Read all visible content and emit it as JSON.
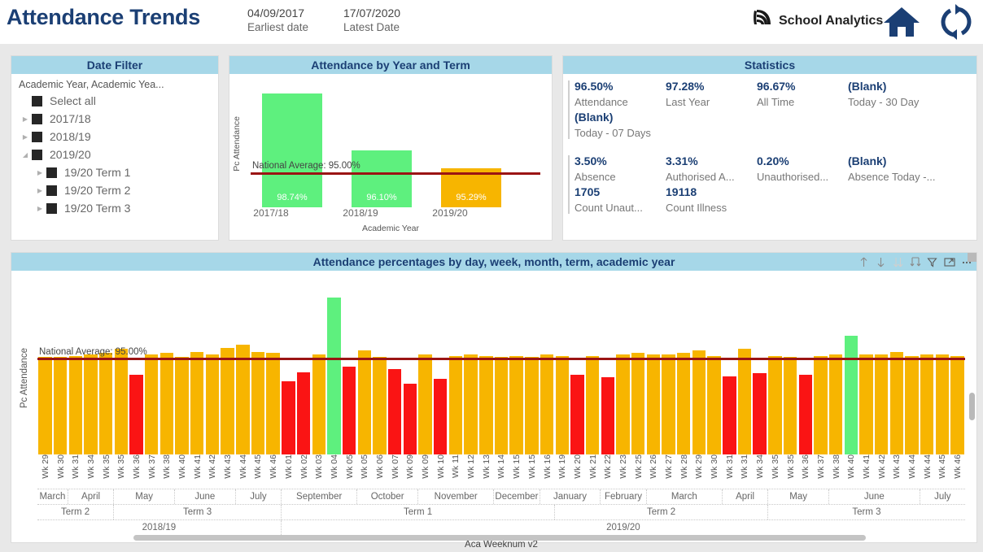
{
  "header": {
    "title": "Attendance Trends",
    "earliest": {
      "value": "04/09/2017",
      "label": "Earliest date"
    },
    "latest": {
      "value": "17/07/2020",
      "label": "Latest Date"
    },
    "brand": "School Analytics",
    "logo_icon": "swirl-logo-icon",
    "home_icon": "home-icon",
    "refresh_icon": "refresh-icon",
    "brand_color": "#1b3f74"
  },
  "date_filter": {
    "title": "Date Filter",
    "caption": "Academic Year, Academic Yea...",
    "items": [
      {
        "label": "Select all",
        "indent": 0,
        "arrow": "",
        "checked": true
      },
      {
        "label": "2017/18",
        "indent": 0,
        "arrow": "collapsed",
        "checked": true
      },
      {
        "label": "2018/19",
        "indent": 0,
        "arrow": "collapsed",
        "checked": true
      },
      {
        "label": "2019/20",
        "indent": 0,
        "arrow": "expanded",
        "checked": true
      },
      {
        "label": "19/20 Term 1",
        "indent": 1,
        "arrow": "collapsed",
        "checked": true
      },
      {
        "label": "19/20 Term 2",
        "indent": 1,
        "arrow": "collapsed",
        "checked": true
      },
      {
        "label": "19/20 Term 3",
        "indent": 1,
        "arrow": "collapsed",
        "checked": true
      }
    ]
  },
  "year_term": {
    "title": "Attendance by Year and Term",
    "ylabel": "Pc Attendance",
    "xlabel": "Academic Year",
    "average_label": "National Average: 95.00%"
  },
  "statistics": {
    "title": "Statistics",
    "groups": [
      {
        "rows": [
          [
            {
              "value": "96.50%",
              "label": "Attendance"
            },
            {
              "value": "97.28%",
              "label": "Last Year"
            },
            {
              "value": "96.67%",
              "label": "All Time"
            },
            {
              "value": "(Blank)",
              "label": "Today - 30 Day"
            }
          ],
          [
            {
              "value": "(Blank)",
              "label": "Today - 07 Days"
            }
          ]
        ]
      },
      {
        "rows": [
          [
            {
              "value": "3.50%",
              "label": "Absence"
            },
            {
              "value": "3.31%",
              "label": "Authorised A..."
            },
            {
              "value": "0.20%",
              "label": "Unauthorised..."
            },
            {
              "value": "(Blank)",
              "label": "Absence Today -..."
            }
          ],
          [
            {
              "value": "1705",
              "label": "Count Unaut..."
            },
            {
              "value": "19118",
              "label": "Count Illness"
            }
          ]
        ]
      }
    ]
  },
  "trend": {
    "title": "Attendance percentages by day, week, month, term, academic year",
    "ylabel": "Pc Attendance",
    "xlabel": "Aca Weeknum v2",
    "average_label": "National Average: 95.00%",
    "toolbar": [
      {
        "icon": "drill-up-icon",
        "label": "Drill up"
      },
      {
        "icon": "drill-down-icon",
        "label": "Drill down"
      },
      {
        "icon": "expand-all-icon",
        "label": "Expand all"
      },
      {
        "icon": "drill-hierarchy-icon",
        "label": "Go to next level"
      },
      {
        "icon": "filter-icon",
        "label": "Filters"
      },
      {
        "icon": "focus-mode-icon",
        "label": "Focus mode"
      },
      {
        "icon": "more-options-icon",
        "label": "More options"
      }
    ]
  },
  "colors": {
    "bar_green": "#5ef07e",
    "bar_orange": "#f7b500",
    "bar_red": "#fa1414",
    "average_line": "#9b1414",
    "panel_header": "#a6d7e8",
    "title_blue": "#1b3f74"
  },
  "chart_data": [
    {
      "type": "bar",
      "title": "Attendance by Year and Term",
      "xlabel": "Academic Year",
      "ylabel": "Pc Attendance",
      "categories": [
        "2017/18",
        "2018/19",
        "2019/20"
      ],
      "values": [
        98.74,
        96.1,
        95.29
      ],
      "data_labels": [
        "98.74%",
        "96.10%",
        "95.29%"
      ],
      "colors": [
        "#5ef07e",
        "#5ef07e",
        "#f7b500"
      ],
      "reference_line": {
        "label": "National Average: 95.00%",
        "value": 95.0,
        "color": "#9b1414"
      },
      "ylim": [
        93.5,
        99.4
      ],
      "grid": false,
      "legend": "none"
    },
    {
      "type": "bar",
      "title": "Attendance percentages by day, week, month, term, academic year",
      "xlabel": "Aca Weeknum v2",
      "ylabel": "Pc Attendance",
      "reference_line": {
        "label": "National Average: 95.00%",
        "value": 95.0,
        "color": "#9b1414"
      },
      "ylim": [
        88.0,
        100.5
      ],
      "grid": false,
      "legend": "none",
      "categories": [
        "Wk 29",
        "Wk 30",
        "Wk 31",
        "Wk 34",
        "Wk 35",
        "Wk 35",
        "Wk 36",
        "Wk 37",
        "Wk 38",
        "Wk 40",
        "Wk 41",
        "Wk 42",
        "Wk 43",
        "Wk 44",
        "Wk 45",
        "Wk 46",
        "Wk 01",
        "Wk 02",
        "Wk 03",
        "Wk 04",
        "Wk 05",
        "Wk 05",
        "Wk 06",
        "Wk 07",
        "Wk 09",
        "Wk 09",
        "Wk 10",
        "Wk 11",
        "Wk 12",
        "Wk 13",
        "Wk 14",
        "Wk 15",
        "Wk 15",
        "Wk 16",
        "Wk 19",
        "Wk 20",
        "Wk 21",
        "Wk 22",
        "Wk 23",
        "Wk 25",
        "Wk 26",
        "Wk 27",
        "Wk 28",
        "Wk 29",
        "Wk 30",
        "Wk 31",
        "Wk 31",
        "Wk 34",
        "Wk 35",
        "Wk 35",
        "Wk 36",
        "Wk 37",
        "Wk 38",
        "Wk 40",
        "Wk 41",
        "Wk 42",
        "Wk 43",
        "Wk 44",
        "Wk 44",
        "Wk 45",
        "Wk 46"
      ],
      "values": [
        95.2,
        95.2,
        95.3,
        95.4,
        95.5,
        95.8,
        93.9,
        95.4,
        95.5,
        95.2,
        95.6,
        95.4,
        95.9,
        96.1,
        95.6,
        95.5,
        93.4,
        94.1,
        95.4,
        99.6,
        94.5,
        95.7,
        95.2,
        94.3,
        93.2,
        95.4,
        93.6,
        95.3,
        95.4,
        95.3,
        95.2,
        95.3,
        95.2,
        95.4,
        95.3,
        93.9,
        95.3,
        93.7,
        95.4,
        95.5,
        95.4,
        95.4,
        95.5,
        95.7,
        95.3,
        93.8,
        95.8,
        94.0,
        95.3,
        95.2,
        93.9,
        95.3,
        95.4,
        96.8,
        95.4,
        95.4,
        95.6,
        95.3,
        95.4,
        95.4,
        95.3
      ],
      "bar_colors": [
        "orange",
        "orange",
        "orange",
        "orange",
        "orange",
        "orange",
        "red",
        "orange",
        "orange",
        "orange",
        "orange",
        "orange",
        "orange",
        "orange",
        "orange",
        "orange",
        "red",
        "red",
        "orange",
        "green",
        "red",
        "orange",
        "orange",
        "red",
        "red",
        "orange",
        "red",
        "orange",
        "orange",
        "orange",
        "orange",
        "orange",
        "orange",
        "orange",
        "orange",
        "red",
        "orange",
        "red",
        "orange",
        "orange",
        "orange",
        "orange",
        "orange",
        "orange",
        "orange",
        "red",
        "orange",
        "red",
        "orange",
        "orange",
        "red",
        "orange",
        "orange",
        "green",
        "orange",
        "orange",
        "orange",
        "orange",
        "orange",
        "orange",
        "orange"
      ],
      "month_bands": [
        {
          "label": "March",
          "span": 2
        },
        {
          "label": "April",
          "span": 3
        },
        {
          "label": "May",
          "span": 4
        },
        {
          "label": "June",
          "span": 4
        },
        {
          "label": "July",
          "span": 3
        },
        {
          "label": "September",
          "span": 5
        },
        {
          "label": "October",
          "span": 4
        },
        {
          "label": "November",
          "span": 5
        },
        {
          "label": "December",
          "span": 3
        },
        {
          "label": "January",
          "span": 4
        },
        {
          "label": "February",
          "span": 3
        },
        {
          "label": "March",
          "span": 5
        },
        {
          "label": "April",
          "span": 3
        },
        {
          "label": "May",
          "span": 4
        },
        {
          "label": "June",
          "span": 6
        },
        {
          "label": "July",
          "span": 3
        }
      ],
      "term_bands": [
        {
          "label": "Term 2",
          "span": 5
        },
        {
          "label": "Term 3",
          "span": 11
        },
        {
          "label": "Term 1",
          "span": 18
        },
        {
          "label": "Term 2",
          "span": 14
        },
        {
          "label": "Term 3",
          "span": 13
        }
      ],
      "year_bands": [
        {
          "label": "2018/19",
          "span": 16
        },
        {
          "label": "2019/20",
          "span": 45
        }
      ]
    }
  ]
}
